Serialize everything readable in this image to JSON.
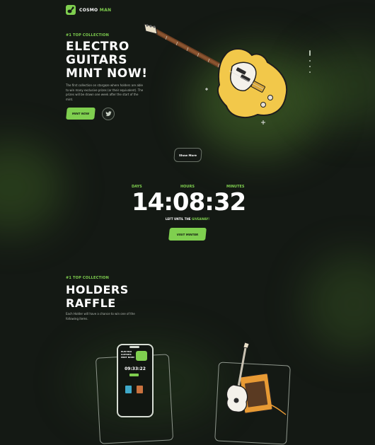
{
  "brand": {
    "name_main": "COSMO",
    "name_accent": "MAN"
  },
  "hero": {
    "eyebrow": "#1 TOP COLLECTION",
    "title_lines": [
      "ELECTRO",
      "GUITARS",
      "MINT NOW!"
    ],
    "description": "The first collection on stargaze where holders are able to win many exclusive prizes (or their equivalent). The prizes will be drawn one week after the start of the mint.",
    "mint_label": "MINT NOW",
    "show_more_label": "Show More"
  },
  "countdown": {
    "labels": [
      "DAYS",
      "HOURS",
      "MINUTES"
    ],
    "time": "14:08:32",
    "left_until_prefix": "LEFT UNTIL THE",
    "left_until_accent": "GIVEAWAY!",
    "visit_label": "VISIT MINTER"
  },
  "raffle": {
    "eyebrow": "#1 TOP COLLECTION",
    "title_lines": [
      "HOLDERS",
      "RAFFLE"
    ],
    "description": "Each Holder will have a chance to win one of the following items.",
    "phone": {
      "title_lines": [
        "ELECTRO",
        "GUITARS",
        "MINT NOW!"
      ],
      "time": "09:33:22"
    }
  },
  "colors": {
    "accent": "#7fcf4f",
    "background": "#141914",
    "guitar_body": "#f2c84a"
  },
  "icons": [
    "guitar-logo-icon",
    "twitter-icon",
    "electric-guitar-illustration",
    "acoustic-guitar-amp-illustration"
  ]
}
